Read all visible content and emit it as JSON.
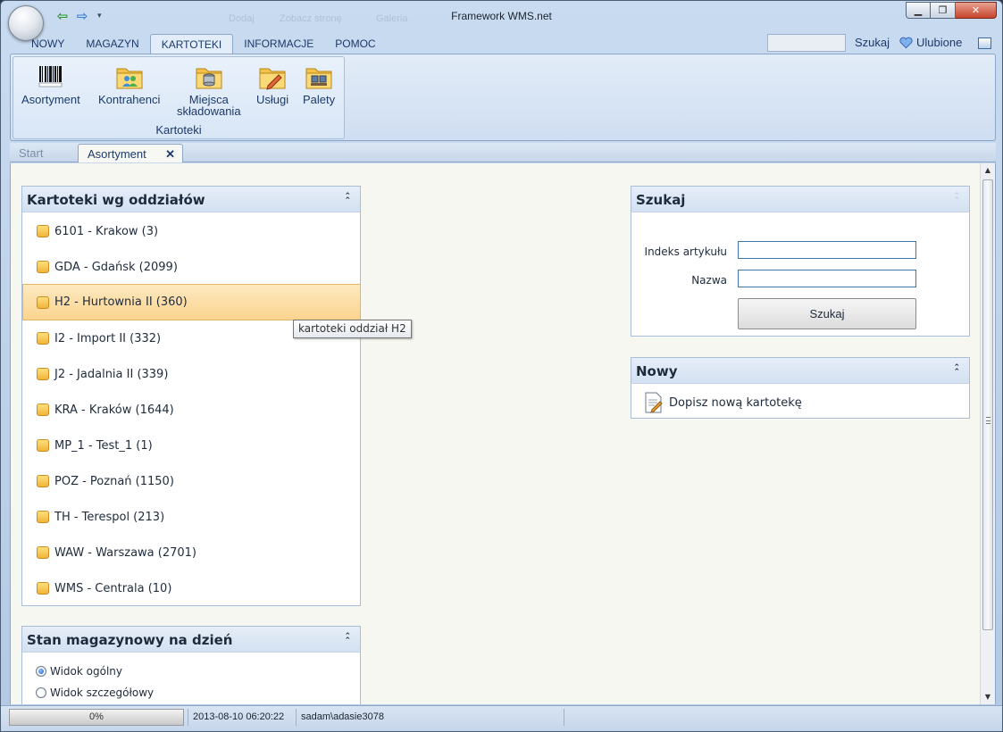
{
  "window": {
    "title": "Framework WMS.net"
  },
  "quick_access": {
    "ghost_items": [
      "Dodaj",
      "Zobacz stronę",
      "Galeria"
    ]
  },
  "ribbon_tabs": [
    {
      "label": "NOWY"
    },
    {
      "label": "MAGAZYN"
    },
    {
      "label": "KARTOTEKI"
    },
    {
      "label": "INFORMACJE"
    },
    {
      "label": "POMOC"
    }
  ],
  "header": {
    "search_label": "Szukaj",
    "favorites_label": "Ulubione"
  },
  "ribbon_group": {
    "label": "Kartoteki",
    "buttons": [
      {
        "label": "Asortyment",
        "icon": "barcode-icon"
      },
      {
        "label": "Kontrahenci",
        "icon": "contacts-folder-icon"
      },
      {
        "label_line1": "Miejsca",
        "label_line2": "składowania",
        "icon": "storage-folder-icon"
      },
      {
        "label": "Usługi",
        "icon": "services-folder-icon"
      },
      {
        "label": "Palety",
        "icon": "pallets-folder-icon"
      }
    ]
  },
  "doc_tabs": {
    "start": "Start",
    "asortyment": "Asortyment"
  },
  "branches_panel": {
    "title": "Kartoteki wg oddziałów",
    "items": [
      {
        "label": "6101 - Krakow (3)"
      },
      {
        "label": "GDA - Gdańsk (2099)"
      },
      {
        "label": "H2 - Hurtownia II (360)"
      },
      {
        "label": "I2 - Import II (332)"
      },
      {
        "label": "J2 - Jadalnia II (339)"
      },
      {
        "label": "KRA - Kraków (1644)"
      },
      {
        "label": "MP_1 - Test_1 (1)"
      },
      {
        "label": "POZ - Poznań (1150)"
      },
      {
        "label": "TH - Terespol (213)"
      },
      {
        "label": "WAW - Warszawa (2701)"
      },
      {
        "label": "WMS - Centrala (10)"
      }
    ],
    "hovered_index": 2,
    "tooltip": "kartoteki oddział H2"
  },
  "stock_panel": {
    "title": "Stan magazynowy na dzień",
    "options": [
      {
        "label": "Widok ogólny",
        "selected": true
      },
      {
        "label": "Widok szczegółowy",
        "selected": false
      }
    ]
  },
  "search_panel": {
    "title": "Szukaj",
    "index_label": "Indeks artykułu",
    "index_value": "",
    "name_label": "Nazwa",
    "name_value": "",
    "button_label": "Szukaj"
  },
  "new_panel": {
    "title": "Nowy",
    "link_label": "Dopisz nową kartotekę"
  },
  "status_bar": {
    "progress_text": "0%",
    "progress_value": 0,
    "datetime": "2013-08-10 06:20:22",
    "user": "sadam\\adasie3078"
  },
  "colors": {
    "accent": "#1c3a6a",
    "hover": "#fbd48f",
    "folder": "#f0b33b"
  }
}
